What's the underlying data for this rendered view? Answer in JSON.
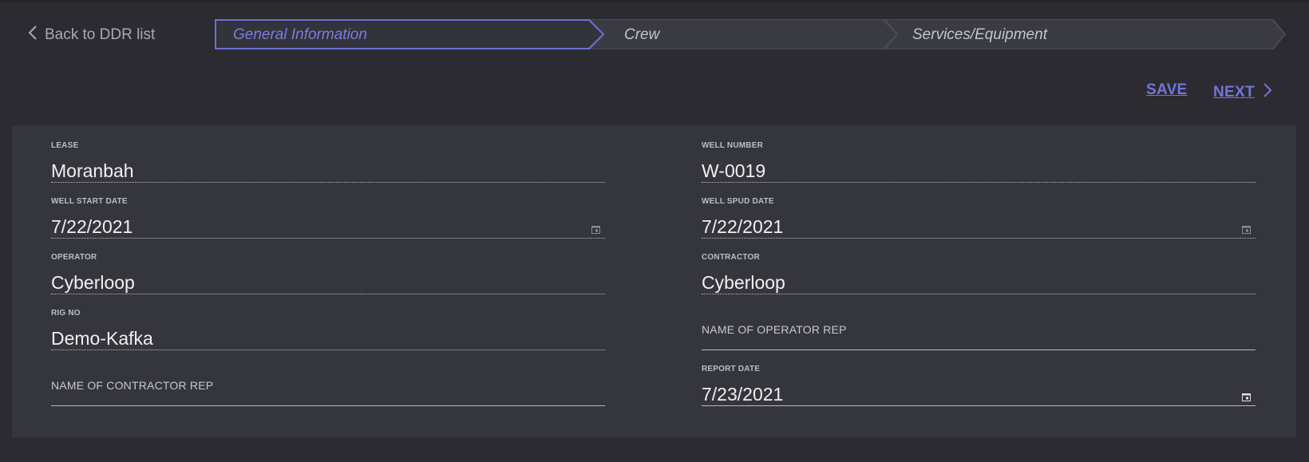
{
  "nav": {
    "back_label": "Back to DDR list"
  },
  "stepper": {
    "steps": [
      {
        "label": "General Information",
        "active": true
      },
      {
        "label": "Crew",
        "active": false
      },
      {
        "label": "Services/Equipment",
        "active": false
      }
    ]
  },
  "actions": {
    "save_label": "SAVE",
    "next_label": "NEXT"
  },
  "form": {
    "lease": {
      "label": "LEASE",
      "value": "Moranbah"
    },
    "well_number": {
      "label": "WELL NUMBER",
      "value": "W-0019"
    },
    "well_start_date": {
      "label": "WELL START DATE",
      "value": "7/22/2021"
    },
    "well_spud_date": {
      "label": "WELL SPUD DATE",
      "value": "7/22/2021"
    },
    "operator": {
      "label": "OPERATOR",
      "value": "Cyberloop"
    },
    "contractor": {
      "label": "CONTRACTOR",
      "value": "Cyberloop"
    },
    "rig_no": {
      "label": "RIG NO",
      "value": "Demo-Kafka"
    },
    "operator_rep": {
      "placeholder": "NAME OF OPERATOR REP"
    },
    "contractor_rep": {
      "placeholder": "NAME OF CONTRACTOR REP"
    },
    "report_date": {
      "label": "REPORT DATE",
      "value": "7/23/2021"
    }
  },
  "colors": {
    "background": "#2b2b31",
    "panel": "#35353d",
    "accent": "#7474dc",
    "step_border": "#4a4a54"
  },
  "icons": [
    "chevron-left-icon",
    "chevron-right-icon",
    "calendar-icon"
  ]
}
